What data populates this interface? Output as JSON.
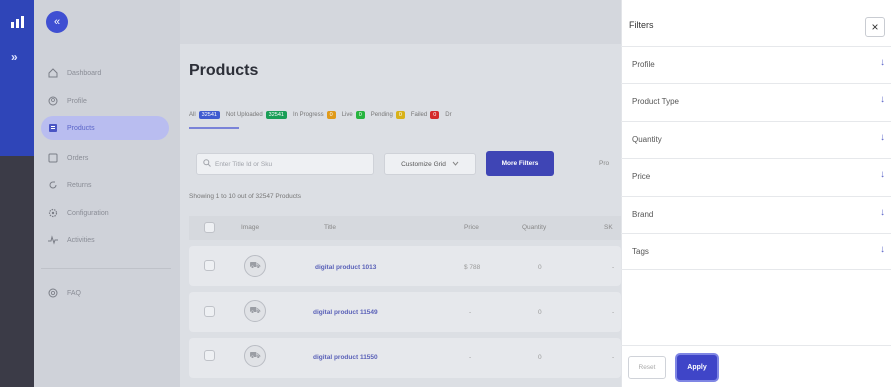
{
  "rail": {
    "expand_glyph": "»"
  },
  "sidebar": {
    "collapse_glyph": "«",
    "items": [
      {
        "label": "Dashboard",
        "icon": "home-icon"
      },
      {
        "label": "Profile",
        "icon": "profile-icon"
      },
      {
        "label": "Products",
        "icon": "products-icon",
        "active": true
      },
      {
        "label": "Orders",
        "icon": "orders-icon"
      },
      {
        "label": "Returns",
        "icon": "returns-icon"
      },
      {
        "label": "Configuration",
        "icon": "gear-icon"
      },
      {
        "label": "Activities",
        "icon": "activity-icon"
      },
      {
        "label": "FAQ",
        "icon": "faq-icon"
      }
    ]
  },
  "main": {
    "title": "Products",
    "tabs": [
      {
        "label": "All",
        "count": "32541",
        "color": "#3f5bd0"
      },
      {
        "label": "Not Uploaded",
        "count": "32541",
        "color": "#1a9e57"
      },
      {
        "label": "In Progress",
        "count": "0",
        "color": "#e09a1a"
      },
      {
        "label": "Live",
        "count": "0",
        "color": "#27b43e"
      },
      {
        "label": "Pending",
        "count": "0",
        "color": "#d8b21a"
      },
      {
        "label": "Failed",
        "count": "0",
        "color": "#d42a2a"
      },
      {
        "label": "Dr",
        "count": "",
        "color": ""
      }
    ],
    "search_placeholder": "Enter Title Id or Sku",
    "customize_label": "Customize Grid",
    "more_filters_label": "More Filters",
    "cut_text": "Pro",
    "showing_text": "Showing 1 to 10 out of 32547 Products",
    "columns": [
      "Image",
      "Title",
      "Price",
      "Quantity",
      "SK"
    ],
    "rows": [
      {
        "title": "digital product 1013",
        "price": "$ 788",
        "quantity": "0",
        "sku": "-"
      },
      {
        "title": "digital product 11549",
        "price": "-",
        "quantity": "0",
        "sku": "-"
      },
      {
        "title": "digital product 11550",
        "price": "-",
        "quantity": "0",
        "sku": "-"
      }
    ]
  },
  "filters": {
    "title": "Filters",
    "close_glyph": "×",
    "items": [
      "Profile",
      "Product Type",
      "Quantity",
      "Price",
      "Brand",
      "Tags"
    ],
    "arrow_glyph": "↓",
    "reset_label": "Reset",
    "apply_label": "Apply"
  }
}
